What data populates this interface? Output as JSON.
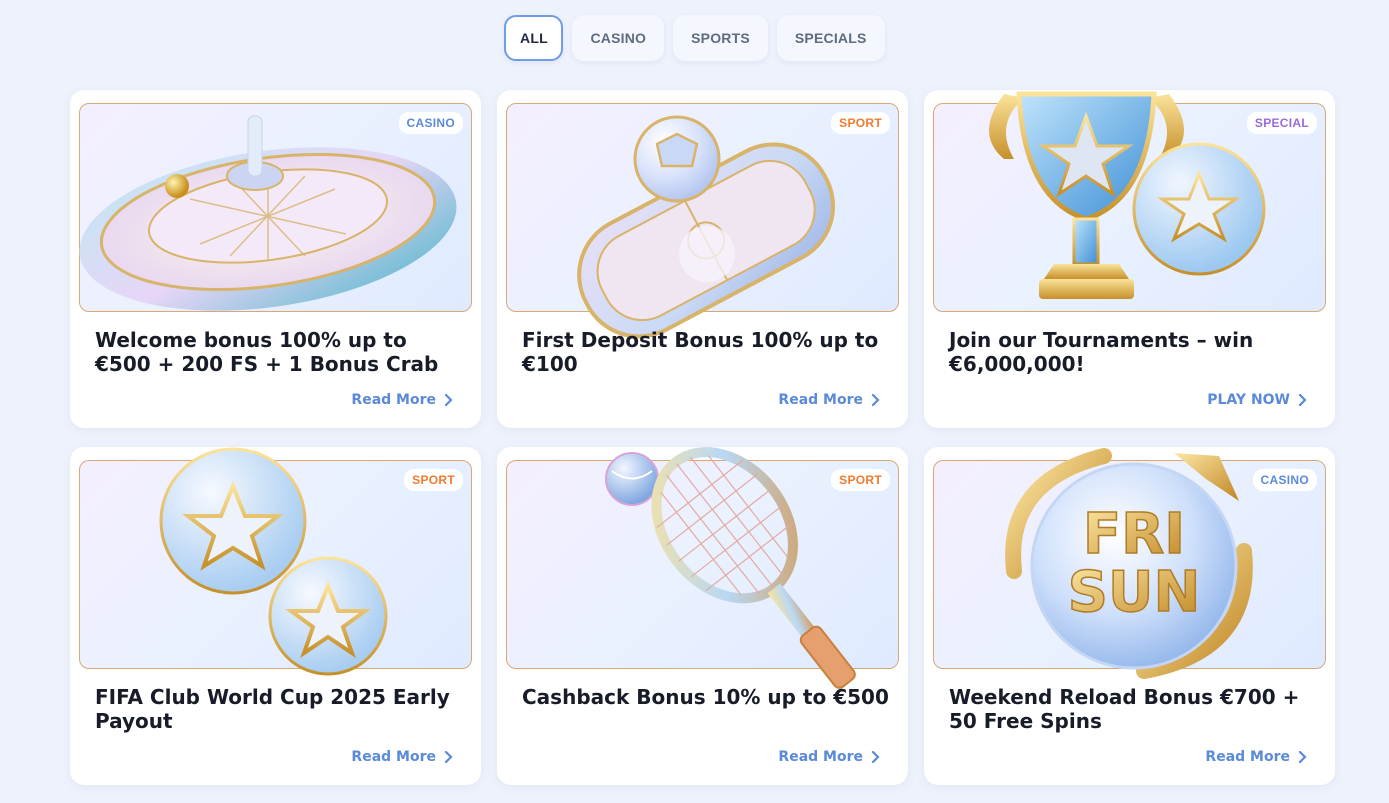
{
  "tabs": [
    {
      "label": "ALL"
    },
    {
      "label": "CASINO"
    },
    {
      "label": "SPORTS"
    },
    {
      "label": "SPECIALS"
    }
  ],
  "colors": {
    "casino_badge": "#5b8ad8",
    "sport_badge": "#f07b2f",
    "special_badge": "#9a6ad8",
    "link": "#5b8ad8"
  },
  "cards": [
    {
      "badge": "CASINO",
      "title": "Welcome bonus 100% up to €500 + 200 FS + 1 Bonus Crab",
      "link": "Read More",
      "image": "roulette-wheel"
    },
    {
      "badge": "SPORT",
      "title": "First Deposit Bonus 100% up to €100",
      "link": "Read More",
      "image": "football-pitch"
    },
    {
      "badge": "SPECIAL",
      "title": "Join our Tournaments – win €6,000,000!",
      "link": "PLAY NOW",
      "image": "trophy-and-ball"
    },
    {
      "badge": "SPORT",
      "title": "FIFA Club World Cup 2025 Early Payout",
      "link": "Read More",
      "image": "star-balls"
    },
    {
      "badge": "SPORT",
      "title": "Cashback Bonus 10% up to €500",
      "link": "Read More",
      "image": "tennis-racket"
    },
    {
      "badge": "CASINO",
      "title": "Weekend Reload Bonus €700 + 50 Free Spins",
      "link": "Read More",
      "image": "fri-sun-bubble"
    }
  ],
  "image_text": {
    "line1": "FRI",
    "line2": "SUN"
  }
}
